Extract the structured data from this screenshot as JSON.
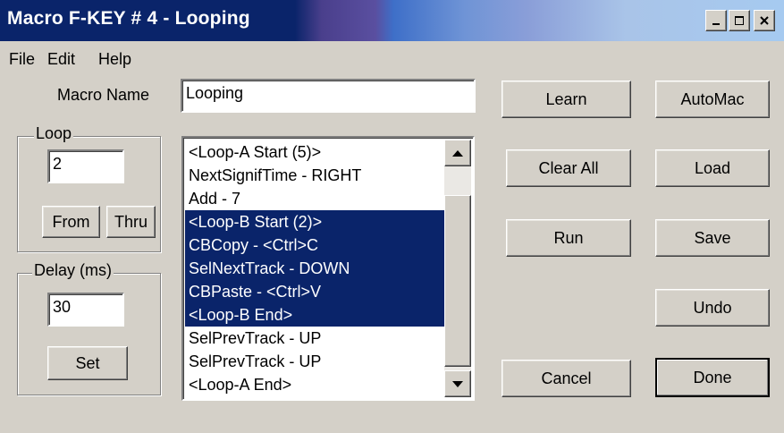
{
  "window": {
    "title": "Macro F-KEY # 4 - Looping",
    "controls": {
      "minimize": "_",
      "maximize": "□",
      "close": "×"
    }
  },
  "menu": {
    "items": [
      "File",
      "Edit",
      "Help"
    ]
  },
  "macro_name": {
    "label": "Macro Name",
    "value": "Looping"
  },
  "loop": {
    "group_label": "Loop",
    "value": "2",
    "from_label": "From",
    "thru_label": "Thru"
  },
  "delay": {
    "group_label": "Delay (ms)",
    "value": "30",
    "set_label": "Set"
  },
  "list": {
    "items": [
      {
        "text": "<Loop-A Start (5)>",
        "selected": false
      },
      {
        "text": "NextSignifTime - RIGHT",
        "selected": false
      },
      {
        "text": "Add - 7",
        "selected": false
      },
      {
        "text": "<Loop-B Start (2)>",
        "selected": true
      },
      {
        "text": "CBCopy - <Ctrl>C",
        "selected": true
      },
      {
        "text": "SelNextTrack - DOWN",
        "selected": true
      },
      {
        "text": "CBPaste - <Ctrl>V",
        "selected": true
      },
      {
        "text": "<Loop-B End>",
        "selected": true
      },
      {
        "text": "SelPrevTrack - UP",
        "selected": false
      },
      {
        "text": "SelPrevTrack - UP",
        "selected": false
      },
      {
        "text": "<Loop-A End>",
        "selected": false
      }
    ]
  },
  "buttons": {
    "learn": "Learn",
    "clear_all": "Clear All",
    "run": "Run",
    "cancel": "Cancel",
    "automac": "AutoMac",
    "load": "Load",
    "save": "Save",
    "undo": "Undo",
    "done": "Done"
  },
  "colors": {
    "face": "#d4d0c8",
    "selection": "#0a246a",
    "title_active": "#0a246a"
  }
}
